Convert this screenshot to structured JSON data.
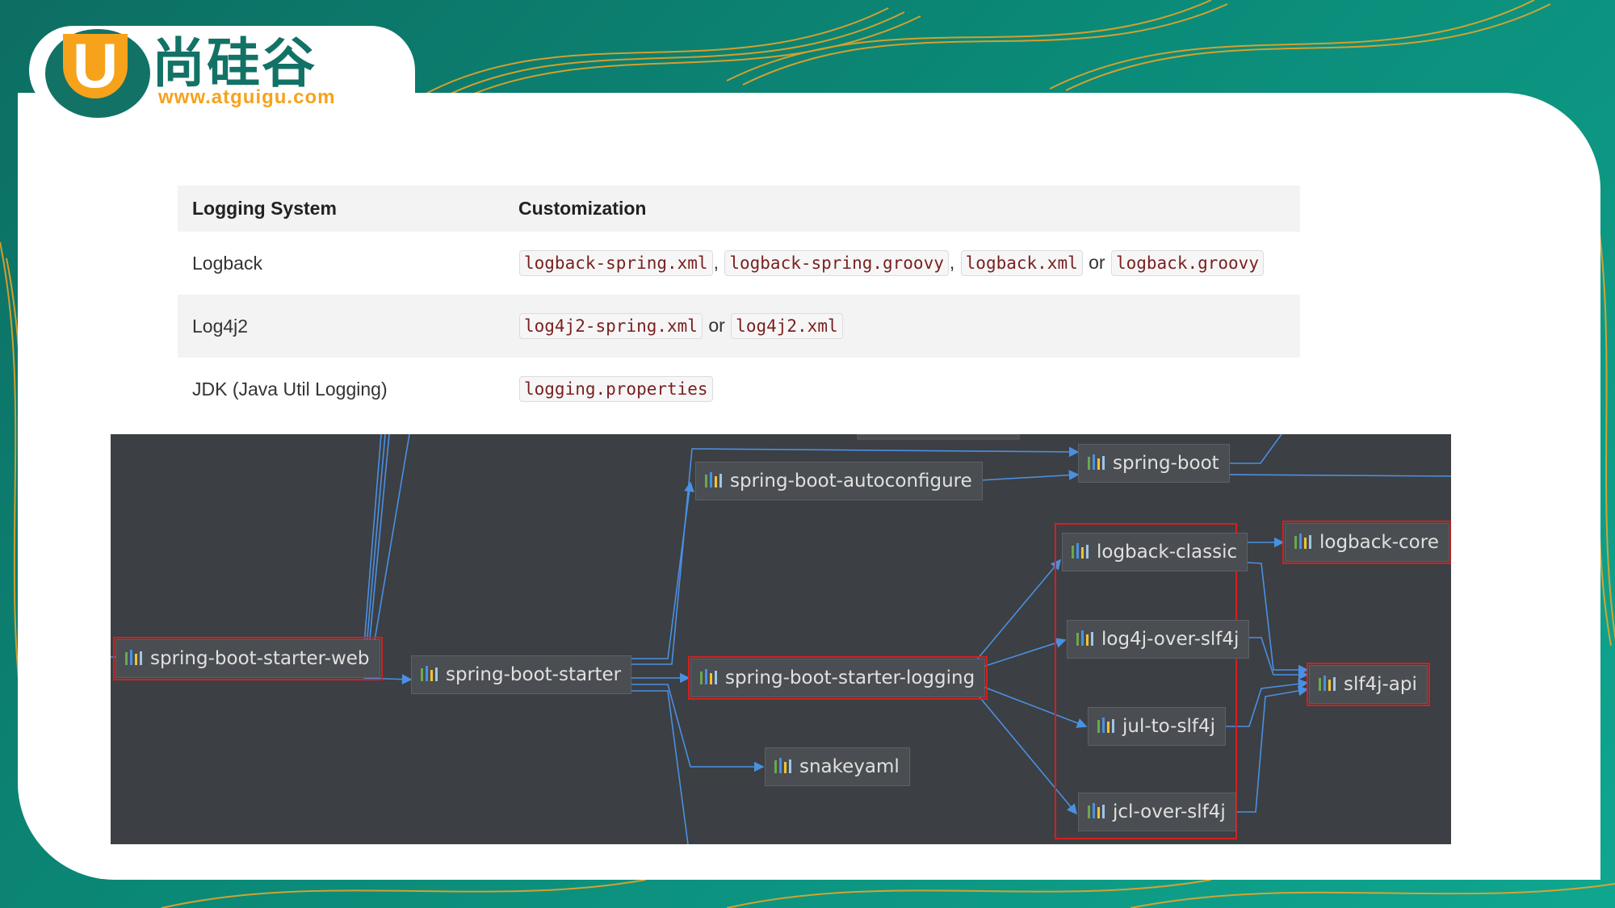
{
  "logo": {
    "cn": "尚硅谷",
    "url": "www.atguigu.com",
    "letter": "U"
  },
  "table": {
    "headers": [
      "Logging System",
      "Customization"
    ],
    "rows": [
      {
        "system": "Logback",
        "files": [
          "logback-spring.xml",
          "logback-spring.groovy",
          "logback.xml",
          "logback.groovy"
        ],
        "seps": [
          ",",
          ",",
          "or"
        ]
      },
      {
        "system": "Log4j2",
        "files": [
          "log4j2-spring.xml",
          "log4j2.xml"
        ],
        "seps": [
          "or"
        ]
      },
      {
        "system": "JDK (Java Util Logging)",
        "files": [
          "logging.properties"
        ],
        "seps": []
      }
    ]
  },
  "diagram": {
    "nodes": {
      "starter_web": "spring-boot-starter-web",
      "starter": "spring-boot-starter",
      "autoconfigure": "spring-boot-autoconfigure",
      "spring_boot": "spring-boot",
      "starter_logging": "spring-boot-starter-logging",
      "snakeyaml": "snakeyaml",
      "logback_classic": "logback-classic",
      "logback_core": "logback-core",
      "log4j_over": "log4j-over-slf4j",
      "jul_to": "jul-to-slf4j",
      "jcl_over": "jcl-over-slf4j",
      "slf4j_api": "slf4j-api"
    },
    "colors": {
      "background": "#3c3f43",
      "edge": "#4a90e2",
      "highlight": "#d61f1f",
      "icon": [
        "#6aa84f",
        "#4a90e2",
        "#f1c232",
        "#9fc5e8"
      ]
    }
  }
}
